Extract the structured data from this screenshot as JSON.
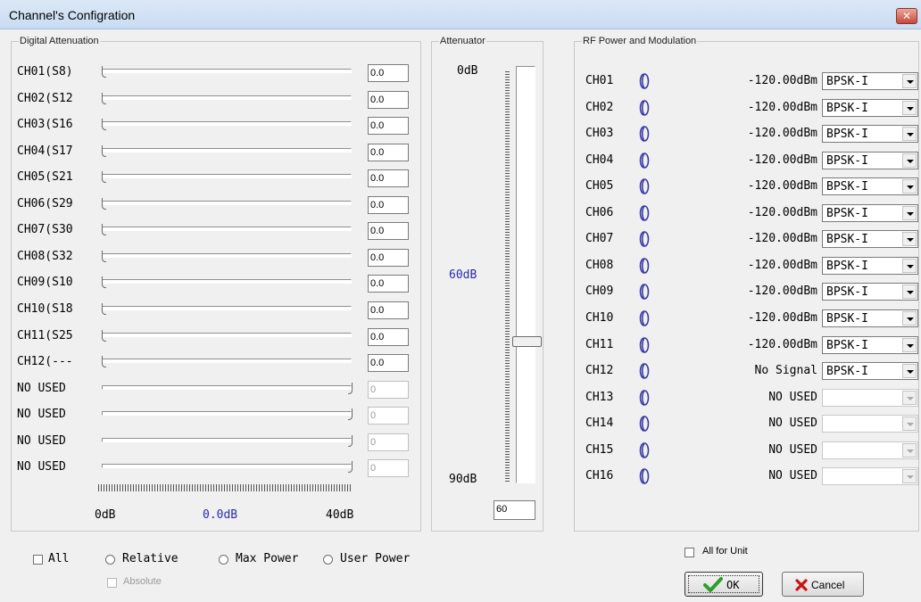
{
  "window": {
    "title": "Channel's Configration",
    "close_glyph": "✕"
  },
  "digital": {
    "group_label": "Digital Attenuation",
    "rows": [
      {
        "label": "CH01(S8)",
        "value": "0.0",
        "enabled": true
      },
      {
        "label": "CH02(S12",
        "value": "0.0",
        "enabled": true
      },
      {
        "label": "CH03(S16",
        "value": "0.0",
        "enabled": true
      },
      {
        "label": "CH04(S17",
        "value": "0.0",
        "enabled": true
      },
      {
        "label": "CH05(S21",
        "value": "0.0",
        "enabled": true
      },
      {
        "label": "CH06(S29",
        "value": "0.0",
        "enabled": true
      },
      {
        "label": "CH07(S30",
        "value": "0.0",
        "enabled": true
      },
      {
        "label": "CH08(S32",
        "value": "0.0",
        "enabled": true
      },
      {
        "label": "CH09(S10",
        "value": "0.0",
        "enabled": true
      },
      {
        "label": "CH10(S18",
        "value": "0.0",
        "enabled": true
      },
      {
        "label": "CH11(S25",
        "value": "0.0",
        "enabled": true
      },
      {
        "label": "CH12(---",
        "value": "0.0",
        "enabled": true
      },
      {
        "label": "NO USED",
        "value": "0",
        "enabled": false
      },
      {
        "label": "NO USED",
        "value": "0",
        "enabled": false
      },
      {
        "label": "NO USED",
        "value": "0",
        "enabled": false
      },
      {
        "label": "NO USED",
        "value": "0",
        "enabled": false
      }
    ],
    "scale": {
      "min_label": "0dB",
      "current_label": "0.0dB",
      "max_label": "40dB"
    }
  },
  "attenuator": {
    "group_label": "Attenuator",
    "top_label": "0dB",
    "mid_label": "60dB",
    "bottom_label": "90dB",
    "value": "60",
    "level_db": 60
  },
  "rf": {
    "group_label": "RF Power and Modulation",
    "rows": [
      {
        "label": "CH01",
        "power": "-120.00dBm",
        "modulation": "BPSK-I",
        "enabled": true
      },
      {
        "label": "CH02",
        "power": "-120.00dBm",
        "modulation": "BPSK-I",
        "enabled": true
      },
      {
        "label": "CH03",
        "power": "-120.00dBm",
        "modulation": "BPSK-I",
        "enabled": true
      },
      {
        "label": "CH04",
        "power": "-120.00dBm",
        "modulation": "BPSK-I",
        "enabled": true
      },
      {
        "label": "CH05",
        "power": "-120.00dBm",
        "modulation": "BPSK-I",
        "enabled": true
      },
      {
        "label": "CH06",
        "power": "-120.00dBm",
        "modulation": "BPSK-I",
        "enabled": true
      },
      {
        "label": "CH07",
        "power": "-120.00dBm",
        "modulation": "BPSK-I",
        "enabled": true
      },
      {
        "label": "CH08",
        "power": "-120.00dBm",
        "modulation": "BPSK-I",
        "enabled": true
      },
      {
        "label": "CH09",
        "power": "-120.00dBm",
        "modulation": "BPSK-I",
        "enabled": true
      },
      {
        "label": "CH10",
        "power": "-120.00dBm",
        "modulation": "BPSK-I",
        "enabled": true
      },
      {
        "label": "CH11",
        "power": "-120.00dBm",
        "modulation": "BPSK-I",
        "enabled": true
      },
      {
        "label": "CH12",
        "power": "No Signal",
        "modulation": "BPSK-I",
        "enabled": true
      },
      {
        "label": "CH13",
        "power": "NO USED",
        "modulation": "",
        "enabled": false
      },
      {
        "label": "CH14",
        "power": "NO USED",
        "modulation": "",
        "enabled": false
      },
      {
        "label": "CH15",
        "power": "NO USED",
        "modulation": "",
        "enabled": false
      },
      {
        "label": "CH16",
        "power": "NO USED",
        "modulation": "",
        "enabled": false
      }
    ]
  },
  "options": {
    "all_label": "All",
    "relative_label": "Relative",
    "max_power_label": "Max Power",
    "user_power_label": "User Power",
    "absolute_label": "Absolute",
    "all_for_unit_label": "All for Unit"
  },
  "buttons": {
    "ok_label": "OK",
    "cancel_label": "Cancel"
  },
  "colors": {
    "accent_blue": "#2a2ab0",
    "speaker": "#3a3aa8",
    "ok_check": "#2aa02a",
    "cancel_x": "#d01010"
  }
}
